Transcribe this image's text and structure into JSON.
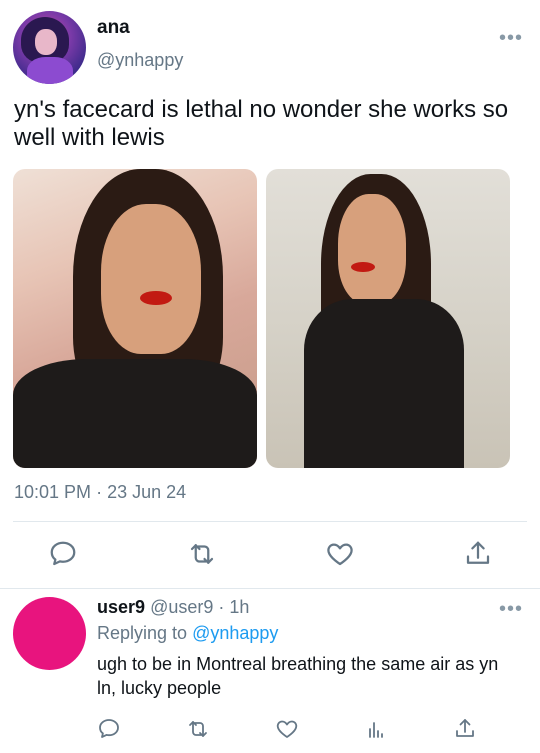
{
  "tweet": {
    "display_name": "ana",
    "handle": "@ynhappy",
    "more": "•••",
    "text": "yn's facecard is lethal no wonder she works so well with lewis",
    "time": "10:01 PM",
    "separator": "·",
    "date": "23 Jun 24",
    "actions": [
      "reply-icon",
      "retweet-icon",
      "like-icon",
      "share-icon"
    ]
  },
  "reply": {
    "display_name": "user9",
    "handle": "@user9",
    "separator": "·",
    "age": "1h",
    "more": "•••",
    "replying_label": "Replying to",
    "replying_to": "@ynhappy",
    "text": "ugh to be in Montreal breathing the same air as yn ln, lucky people",
    "actions": [
      "reply-icon",
      "retweet-icon",
      "like-icon",
      "analytics-icon",
      "share-icon"
    ]
  },
  "colors": {
    "accent": "#1d9bf0",
    "secondary_text": "#657786",
    "reply_avatar": "#e8147e",
    "icon": "#657786"
  }
}
